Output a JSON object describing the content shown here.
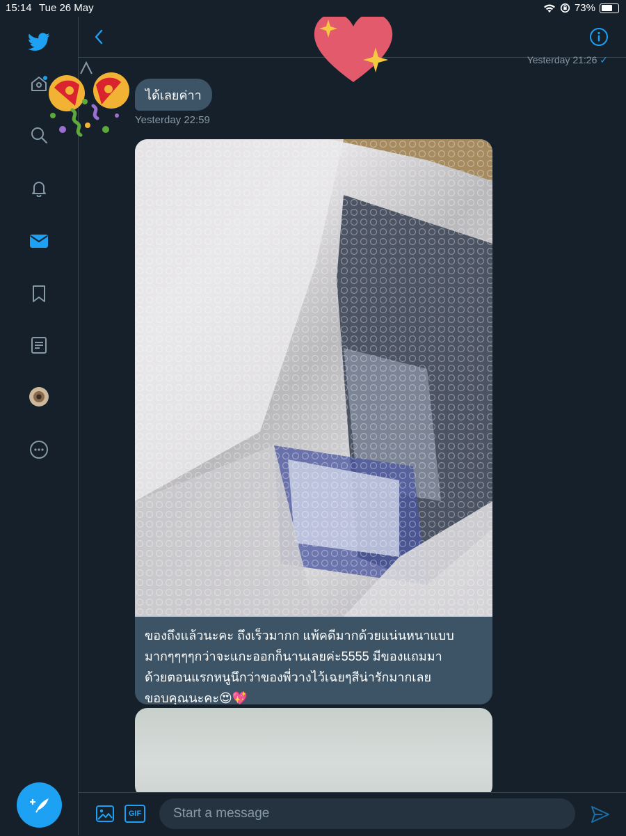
{
  "status_bar": {
    "time": "15:14",
    "date": "Tue 26 May",
    "battery": "73%",
    "battery_level": 0.73
  },
  "sidebar": {
    "items": [
      {
        "name": "home",
        "icon": "home-icon"
      },
      {
        "name": "explore",
        "icon": "search-icon"
      },
      {
        "name": "notifications",
        "icon": "bell-icon"
      },
      {
        "name": "messages",
        "icon": "envelope-icon",
        "active": true
      },
      {
        "name": "bookmarks",
        "icon": "bookmark-icon"
      },
      {
        "name": "lists",
        "icon": "list-icon"
      },
      {
        "name": "profile",
        "icon": "avatar"
      },
      {
        "name": "more",
        "icon": "more-icon"
      }
    ]
  },
  "conversation": {
    "top_timestamp": "Yesterday 21:26",
    "messages": [
      {
        "text": "ได้เลยค่าา",
        "timestamp": "Yesterday 22:59"
      },
      {
        "caption_lines": [
          "ของถึงแล้วนะคะ ถึงเร็วมากก แพ้คดีมากด้วยแน่นหนาแบบ",
          "มากๆๆๆๆกว่าจะแกะออกก็นานเลยค่ะ5555 มีของแถมมา",
          "ด้วยตอนแรกหนูนึกว่าของพี่วางไว้เฉยๆสีน่ารักมากเลย",
          "ขอบคุณนะคะ😍💖"
        ]
      }
    ]
  },
  "composer": {
    "placeholder": "Start a message",
    "gif_label": "GIF"
  },
  "colors": {
    "background": "#15202b",
    "accent": "#1da1f2",
    "bubble": "#3d5466",
    "muted": "#8899a6",
    "border": "#38444d"
  }
}
